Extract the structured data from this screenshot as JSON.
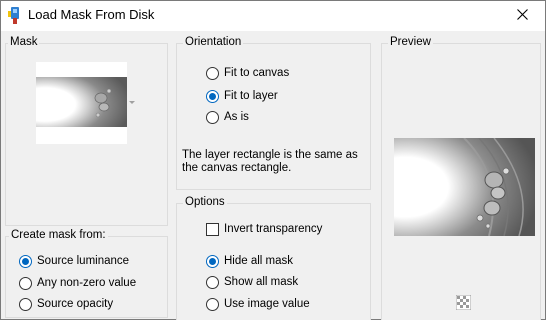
{
  "window": {
    "title": "Load Mask From Disk",
    "close_icon": "close-icon",
    "app_icon": "paint-app-icon"
  },
  "mask": {
    "label": "Mask",
    "thumb_dropdown": "chevron-down-icon"
  },
  "orientation": {
    "label": "Orientation",
    "options": [
      "Fit to canvas",
      "Fit to layer",
      "As is"
    ],
    "selected": "Fit to layer",
    "info": "The layer rectangle is the same as the canvas rectangle."
  },
  "create_mask": {
    "label": "Create mask from:",
    "options": [
      "Source luminance",
      "Any non-zero value",
      "Source opacity"
    ],
    "selected": "Source luminance"
  },
  "options": {
    "label": "Options",
    "invert_label": "Invert transparency",
    "invert_checked": false,
    "radios": [
      "Hide all mask",
      "Show all mask",
      "Use image value"
    ],
    "selected": "Hide all mask"
  },
  "preview": {
    "label": "Preview",
    "checker_icon": "transparency-checker-icon"
  },
  "colors": {
    "accent": "#0067c0",
    "panel": "#f0f0f0"
  }
}
